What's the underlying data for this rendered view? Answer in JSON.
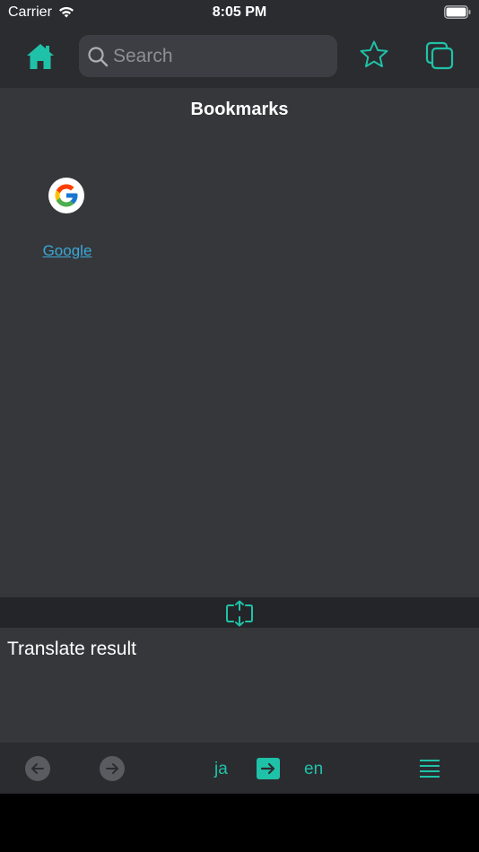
{
  "status_bar": {
    "carrier": "Carrier",
    "time": "8:05 PM"
  },
  "nav": {
    "search": {
      "placeholder": "Search",
      "value": ""
    },
    "icons": [
      "home-icon",
      "search-icon",
      "star-icon",
      "tabs-icon"
    ]
  },
  "bookmarks": {
    "title": "Bookmarks",
    "items": [
      {
        "label": "Google",
        "icon": "google-icon"
      }
    ]
  },
  "translate": {
    "result_text": "Translate result",
    "source_lang": "ja",
    "target_lang": "en"
  },
  "toolbar": {
    "icons": [
      "back-icon",
      "forward-icon",
      "arrow-right-icon",
      "menu-icon"
    ]
  },
  "colors": {
    "accent": "#1fc2a8",
    "link": "#3aa8d8",
    "bar_bg": "#2b2c30",
    "content_bg": "#36373b"
  }
}
